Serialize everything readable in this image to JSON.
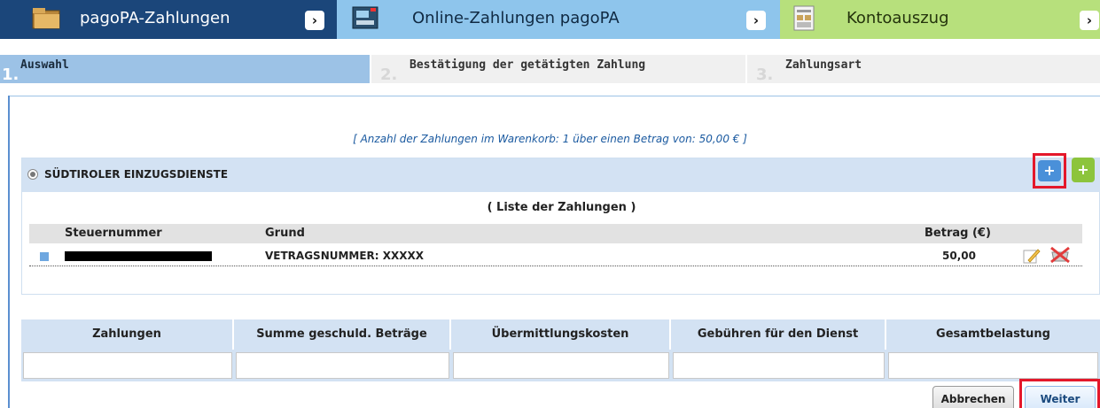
{
  "top_tabs": [
    {
      "label": "pagoPA-Zahlungen",
      "icon": "folder-icon",
      "color": "#1b467a"
    },
    {
      "label": "Online-Zahlungen pagoPA",
      "icon": "card-terminal-icon",
      "color": "#8ec5ec"
    },
    {
      "label": "Kontoauszug",
      "icon": "statement-icon",
      "color": "#b7e07c"
    }
  ],
  "arrow_glyph": "›",
  "steps": [
    {
      "number": "1.",
      "label": "Auswahl",
      "active": true
    },
    {
      "number": "2.",
      "label": "Bestätigung der getätigten Zahlung",
      "active": false
    },
    {
      "number": "3.",
      "label": "Zahlungsart",
      "active": false
    }
  ],
  "cart_info": "[ Anzahl der Zahlungen im Warenkorb: 1 über einen Betrag von: 50,00 € ]",
  "service": {
    "name": "SÜDTIROLER EINZUGSDIENSTE",
    "add_blue_label": "+",
    "add_green_label": "+",
    "list_title": "( Liste der Zahlungen )",
    "columns": {
      "tax_number": "Steuernummer",
      "reason": "Grund",
      "amount": "Betrag (€)"
    },
    "payments": [
      {
        "tax_number_redacted": true,
        "reason": "VETRAGSNUMMER: XXXXX",
        "amount": "50,00"
      }
    ]
  },
  "summary": {
    "columns": [
      "Zahlungen",
      "Summe geschuld. Beträge",
      "Übermittlungskosten",
      "Gebühren für den Dienst",
      "Gesamtbelastung"
    ],
    "values": [
      "",
      "",
      "",
      "",
      ""
    ]
  },
  "buttons": {
    "cancel": "Abbrechen",
    "next": "Weiter"
  },
  "colors": {
    "highlight": "#e4182b",
    "header_blue": "#d3e2f3",
    "accent": "#4a90d9"
  }
}
